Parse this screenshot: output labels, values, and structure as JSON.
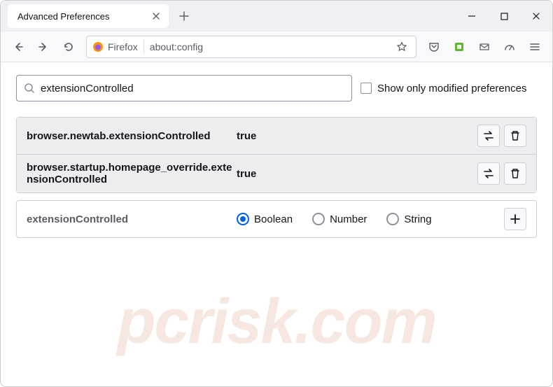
{
  "tab": {
    "title": "Advanced Preferences"
  },
  "urlbar": {
    "identity_label": "Firefox",
    "url": "about:config"
  },
  "search": {
    "value": "extensionControlled",
    "checkbox_label": "Show only modified preferences"
  },
  "prefs": [
    {
      "name": "browser.newtab.extensionControlled",
      "value": "true"
    },
    {
      "name": "browser.startup.homepage_override.extensionControlled",
      "value": "true"
    }
  ],
  "new_pref": {
    "name": "extensionControlled",
    "types": {
      "boolean": "Boolean",
      "number": "Number",
      "string": "String"
    }
  },
  "watermark": "pcrisk.com"
}
